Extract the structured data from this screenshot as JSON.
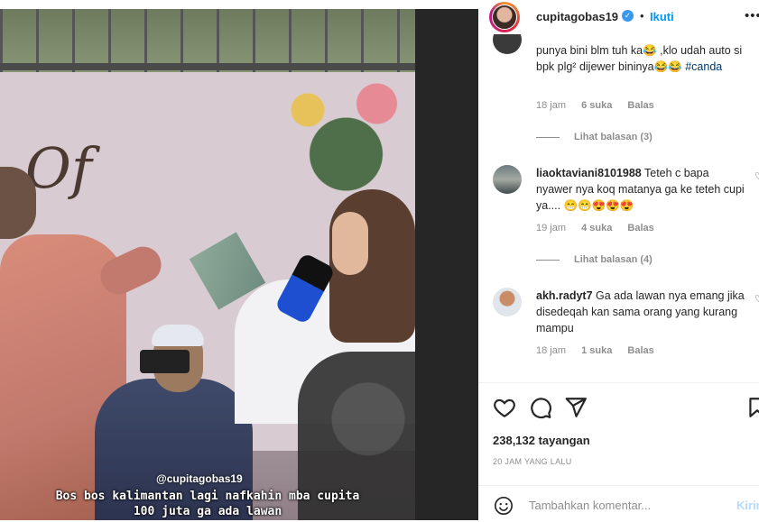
{
  "post": {
    "username": "cupitagobas19",
    "follow_label": "Ikuti",
    "dot": "•",
    "verified_icon": "✓",
    "more_icon": "•••"
  },
  "media": {
    "caption_handle": "@cupitagobas19",
    "caption_line1": "Bos bos kalimantan lagi nafkahin mba cupita",
    "caption_line2": "100 juta ga ada lawan",
    "backdrop_script": "Of"
  },
  "comments": [
    {
      "text": "punya bini blm tuh ka😂 ,klo udah auto si bpk plg² dijewer bininya😂😂 ",
      "hashtag": "#canda",
      "time": "18 jam",
      "likes": "6 suka",
      "reply": "Balas",
      "view_replies": "Lihat balasan (3)"
    },
    {
      "user": "liaoktaviani8101988",
      "text": "Teteh c bapa nyawer nya koq matanya ga ke teteh cupi ya.... 😁😁😍😍😍",
      "time": "19 jam",
      "likes": "4 suka",
      "reply": "Balas",
      "view_replies": "Lihat balasan (4)"
    },
    {
      "user": "akh.radyt7",
      "text": "Ga ada lawan nya emang jika disedeqah kan sama orang yang kurang mampu",
      "time": "18 jam",
      "likes": "1 suka",
      "reply": "Balas"
    }
  ],
  "footer": {
    "views": "238,132 tayangan",
    "time_ago": "20 JAM YANG LALU",
    "add_comment_placeholder": "Tambahkan komentar...",
    "post_label": "Kirim"
  },
  "colors": {
    "accent": "#0095f6",
    "muted": "#8e8e8e",
    "text": "#262626"
  }
}
